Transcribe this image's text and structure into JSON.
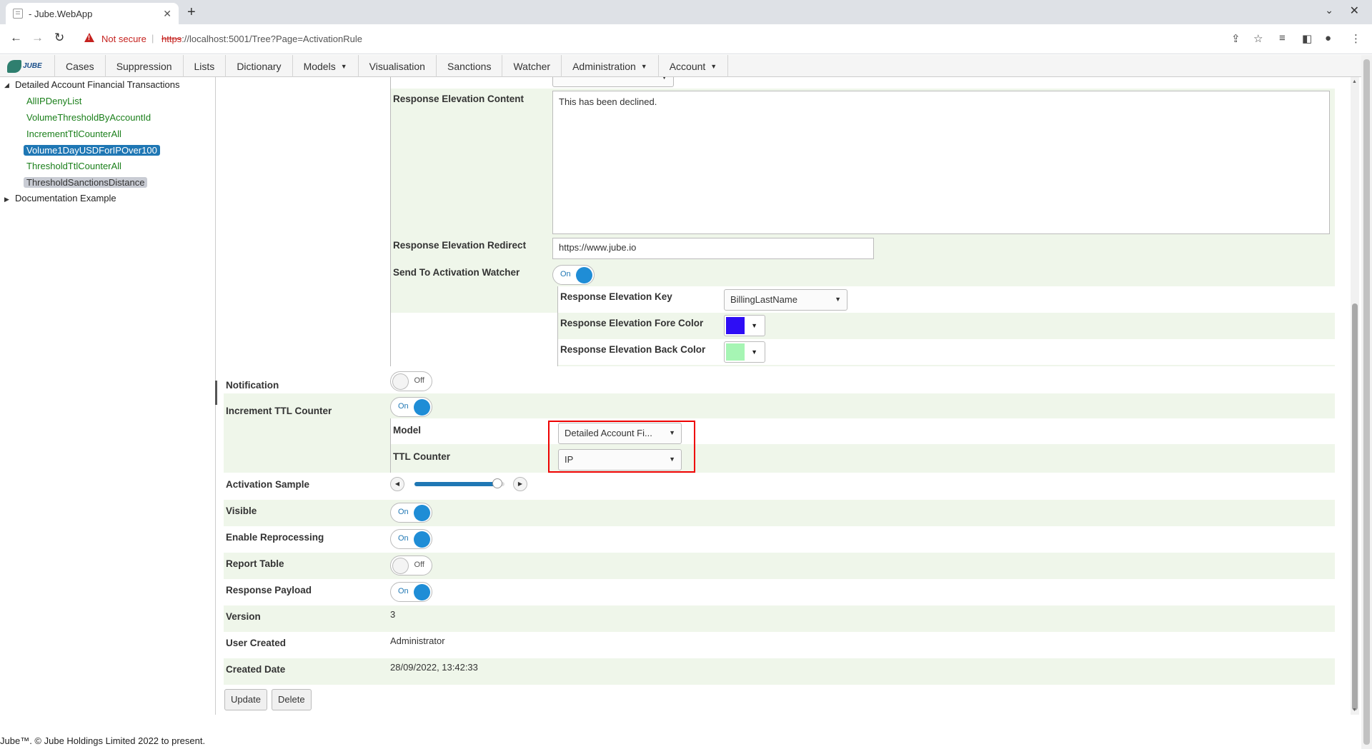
{
  "browser": {
    "tab_title": "- Jube.WebApp",
    "tab_close": "✕",
    "new_tab": "+",
    "security_label": "Not secure",
    "url_scheme": "https",
    "url_rest": "://localhost:5001/Tree?Page=ActivationRule"
  },
  "app": {
    "logo_text": "JUBE",
    "menu": [
      {
        "label": "Cases"
      },
      {
        "label": "Suppression"
      },
      {
        "label": "Lists"
      },
      {
        "label": "Dictionary"
      },
      {
        "label": "Models",
        "dropdown": true
      },
      {
        "label": "Visualisation"
      },
      {
        "label": "Sanctions"
      },
      {
        "label": "Watcher"
      },
      {
        "label": "Administration",
        "dropdown": true
      },
      {
        "label": "Account",
        "dropdown": true
      }
    ]
  },
  "tree": {
    "root_expanded": "Detailed Account Financial Transactions",
    "items": [
      {
        "label": "AllIPDenyList",
        "state": "normal"
      },
      {
        "label": "VolumeThresholdByAccountId",
        "state": "normal"
      },
      {
        "label": "IncrementTtlCounterAll",
        "state": "normal"
      },
      {
        "label": "Volume1DayUSDForIPOver100",
        "state": "selected"
      },
      {
        "label": "ThresholdTtlCounterAll",
        "state": "normal"
      },
      {
        "label": "ThresholdSanctionsDistance",
        "state": "hover"
      }
    ],
    "root_collapsed": "Documentation Example"
  },
  "form": {
    "response_elevation_content": {
      "label": "Response Elevation Content",
      "value": "This has been declined."
    },
    "response_elevation_redirect": {
      "label": "Response Elevation Redirect",
      "value": "https://www.jube.io"
    },
    "send_to_activation_watcher": {
      "label": "Send To Activation Watcher",
      "state": "On"
    },
    "response_elevation_key": {
      "label": "Response Elevation Key",
      "value": "BillingLastName"
    },
    "response_elevation_fore_color": {
      "label": "Response Elevation Fore Color",
      "color": "#2e0df5"
    },
    "response_elevation_back_color": {
      "label": "Response Elevation Back Color",
      "color": "#a6f5b4"
    },
    "notification": {
      "label": "Notification",
      "state": "Off"
    },
    "increment_ttl_counter": {
      "label": "Increment TTL Counter",
      "state": "On"
    },
    "model": {
      "label": "Model",
      "value": "Detailed Account Fi..."
    },
    "ttl_counter": {
      "label": "TTL Counter",
      "value": "IP"
    },
    "activation_sample": {
      "label": "Activation Sample",
      "value_fraction": 0.92
    },
    "visible": {
      "label": "Visible",
      "state": "On"
    },
    "enable_reprocessing": {
      "label": "Enable Reprocessing",
      "state": "On"
    },
    "report_table": {
      "label": "Report Table",
      "state": "Off"
    },
    "response_payload": {
      "label": "Response Payload",
      "state": "On"
    },
    "version": {
      "label": "Version",
      "value": "3"
    },
    "user_created": {
      "label": "User Created",
      "value": "Administrator"
    },
    "created_date": {
      "label": "Created Date",
      "value": "28/09/2022, 13:42:33"
    }
  },
  "buttons": {
    "update": "Update",
    "delete": "Delete"
  },
  "footer": "Jube™. © Jube Holdings Limited 2022 to present.",
  "colors": {
    "accent": "#1f77b4",
    "tree_leaf": "#1a7f1a",
    "row_alt": "#eff6ea",
    "highlight": "#ee0000"
  }
}
